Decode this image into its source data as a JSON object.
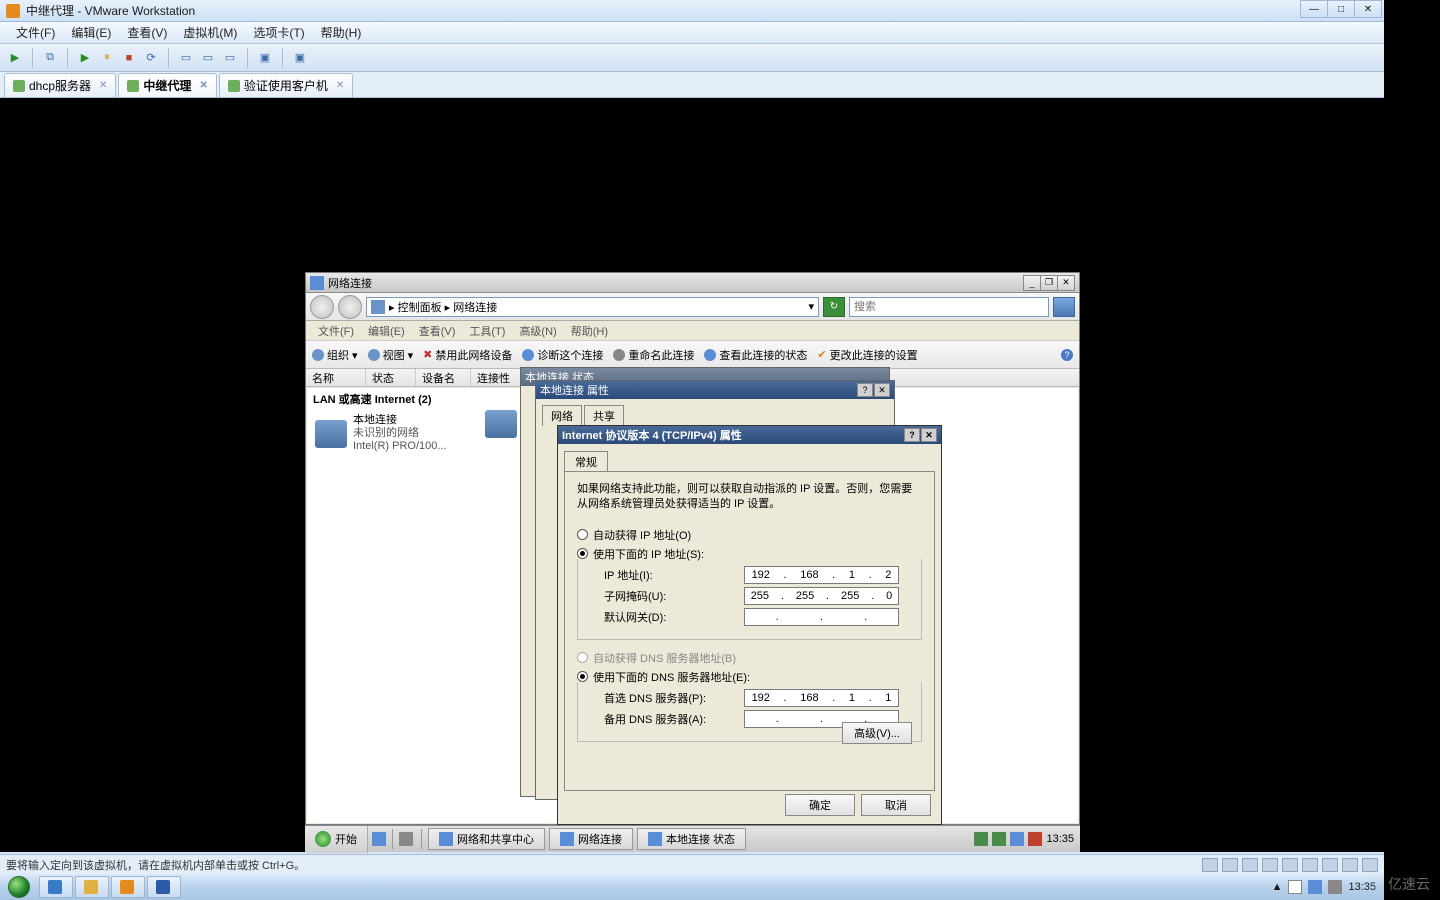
{
  "vmware": {
    "title": "中继代理 - VMware Workstation",
    "menu": {
      "file": "文件(F)",
      "edit": "编辑(E)",
      "view": "查看(V)",
      "vm": "虚拟机(M)",
      "tabs": "选项卡(T)",
      "help": "帮助(H)"
    },
    "tabs": [
      {
        "label": "dhcp服务器"
      },
      {
        "label": "中继代理"
      },
      {
        "label": "验证使用客户机"
      }
    ],
    "status": "要将输入定向到该虚拟机，请在虚拟机内部单击或按 Ctrl+G。"
  },
  "guest": {
    "netwin_title": "网络连接",
    "breadcrumb": "▸ 控制面板 ▸ 网络连接",
    "search_placeholder": "搜索",
    "menubar": {
      "file": "文件(F)",
      "edit": "编辑(E)",
      "view": "查看(V)",
      "tools": "工具(T)",
      "adv": "高级(N)",
      "help": "帮助(H)"
    },
    "toolbar": {
      "org": "组织 ▾",
      "views": "视图 ▾",
      "disable": "禁用此网络设备",
      "diag": "诊断这个连接",
      "rename": "重命名此连接",
      "status": "查看此连接的状态",
      "change": "更改此连接的设置"
    },
    "listhdr": {
      "name": "名称",
      "status": "状态",
      "device": "设备名",
      "conn": "连接性"
    },
    "group": "LAN 或高速 Internet (2)",
    "item": {
      "name": "本地连接",
      "line2": "未识别的网络",
      "line3": "Intel(R) PRO/100..."
    },
    "shadow1_title": "本地连接 状态",
    "shadow2_title": "本地连接 属性",
    "shadow2_tabs": {
      "t1": "网络",
      "t2": "共享"
    },
    "prop": {
      "title": "Internet 协议版本 4 (TCP/IPv4) 属性",
      "tab": "常规",
      "desc": "如果网络支持此功能，则可以获取自动指派的 IP 设置。否则，您需要从网络系统管理员处获得适当的 IP 设置。",
      "radio_auto_ip": "自动获得 IP 地址(O)",
      "radio_man_ip": "使用下面的 IP 地址(S):",
      "lbl_ip": "IP 地址(I):",
      "lbl_mask": "子网掩码(U):",
      "lbl_gw": "默认网关(D):",
      "radio_auto_dns": "自动获得 DNS 服务器地址(B)",
      "radio_man_dns": "使用下面的 DNS 服务器地址(E):",
      "lbl_dns1": "首选 DNS 服务器(P):",
      "lbl_dns2": "备用 DNS 服务器(A):",
      "val_ip": [
        "192",
        "168",
        "1",
        "2"
      ],
      "val_mask": [
        "255",
        "255",
        "255",
        "0"
      ],
      "val_gw": [
        "",
        "",
        "",
        ""
      ],
      "val_dns1": [
        "192",
        "168",
        "1",
        "1"
      ],
      "val_dns2": [
        "",
        "",
        "",
        ""
      ],
      "btn_adv": "高级(V)...",
      "btn_ok": "确定",
      "btn_cancel": "取消"
    },
    "taskbar": {
      "start": "开始",
      "t1": "网络和共享中心",
      "t2": "网络连接",
      "t3": "本地连接 状态",
      "time": "13:35"
    }
  },
  "host": {
    "time": "13:35",
    "date": "",
    "watermark": "亿速云"
  }
}
